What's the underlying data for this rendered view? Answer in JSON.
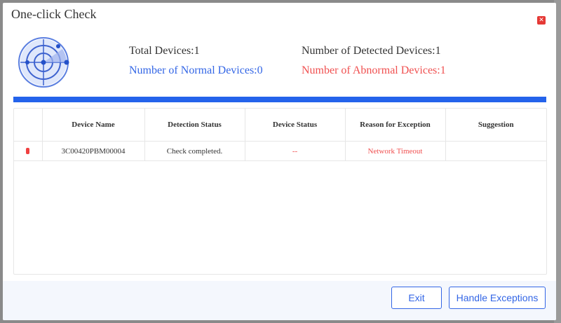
{
  "dialog": {
    "title": "One-click Check",
    "close_icon": "close-icon",
    "radar_icon": "radar-icon"
  },
  "stats": {
    "total_devices": "Total Devices:1",
    "detected_devices": "Number of Detected Devices:1",
    "normal_devices": "Number of Normal Devices:0",
    "abnormal_devices": "Number of Abnormal Devices:1"
  },
  "progress": {
    "percent": 100
  },
  "table": {
    "headers": [
      "",
      "Device Name",
      "Detection Status",
      "Device Status",
      "Reason for Exception",
      "Suggestion"
    ],
    "rows": [
      {
        "status_indicator": "error",
        "device_name": "3C00420PBM00004",
        "detection_status": "Check completed.",
        "device_status": "--",
        "reason": "Network Timeout",
        "suggestion": ""
      }
    ]
  },
  "footer": {
    "exit_label": "Exit",
    "handle_label": "Handle Exceptions"
  },
  "colors": {
    "accent_blue": "#2463eb",
    "normal_text": "#3366e6",
    "abnormal_text": "#f05050",
    "close_red": "#e53935"
  }
}
